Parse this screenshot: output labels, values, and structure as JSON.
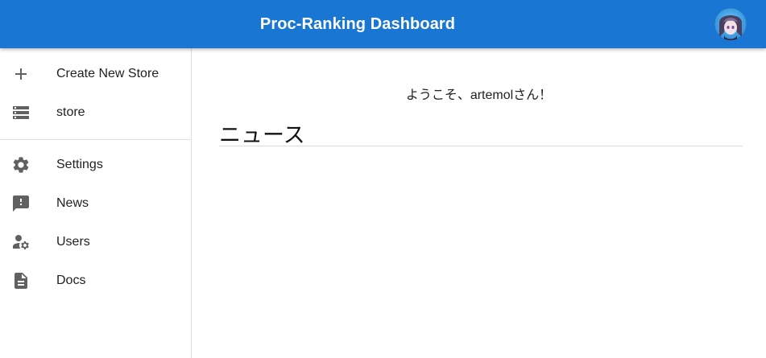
{
  "header": {
    "title": "Proc-Ranking Dashboard",
    "avatar_icon": "user-avatar",
    "background_color": "#1976d2"
  },
  "sidebar": {
    "items": [
      {
        "label": "Create New Store",
        "icon": "plus-icon"
      },
      {
        "label": "store",
        "icon": "storage-icon"
      },
      {
        "label": "Settings",
        "icon": "gear-icon"
      },
      {
        "label": "News",
        "icon": "feedback-icon"
      },
      {
        "label": "Users",
        "icon": "user-settings-icon"
      },
      {
        "label": "Docs",
        "icon": "document-icon"
      }
    ]
  },
  "main": {
    "welcome_text": "ようこそ、artemolさん！",
    "news_heading": "ニュース"
  }
}
